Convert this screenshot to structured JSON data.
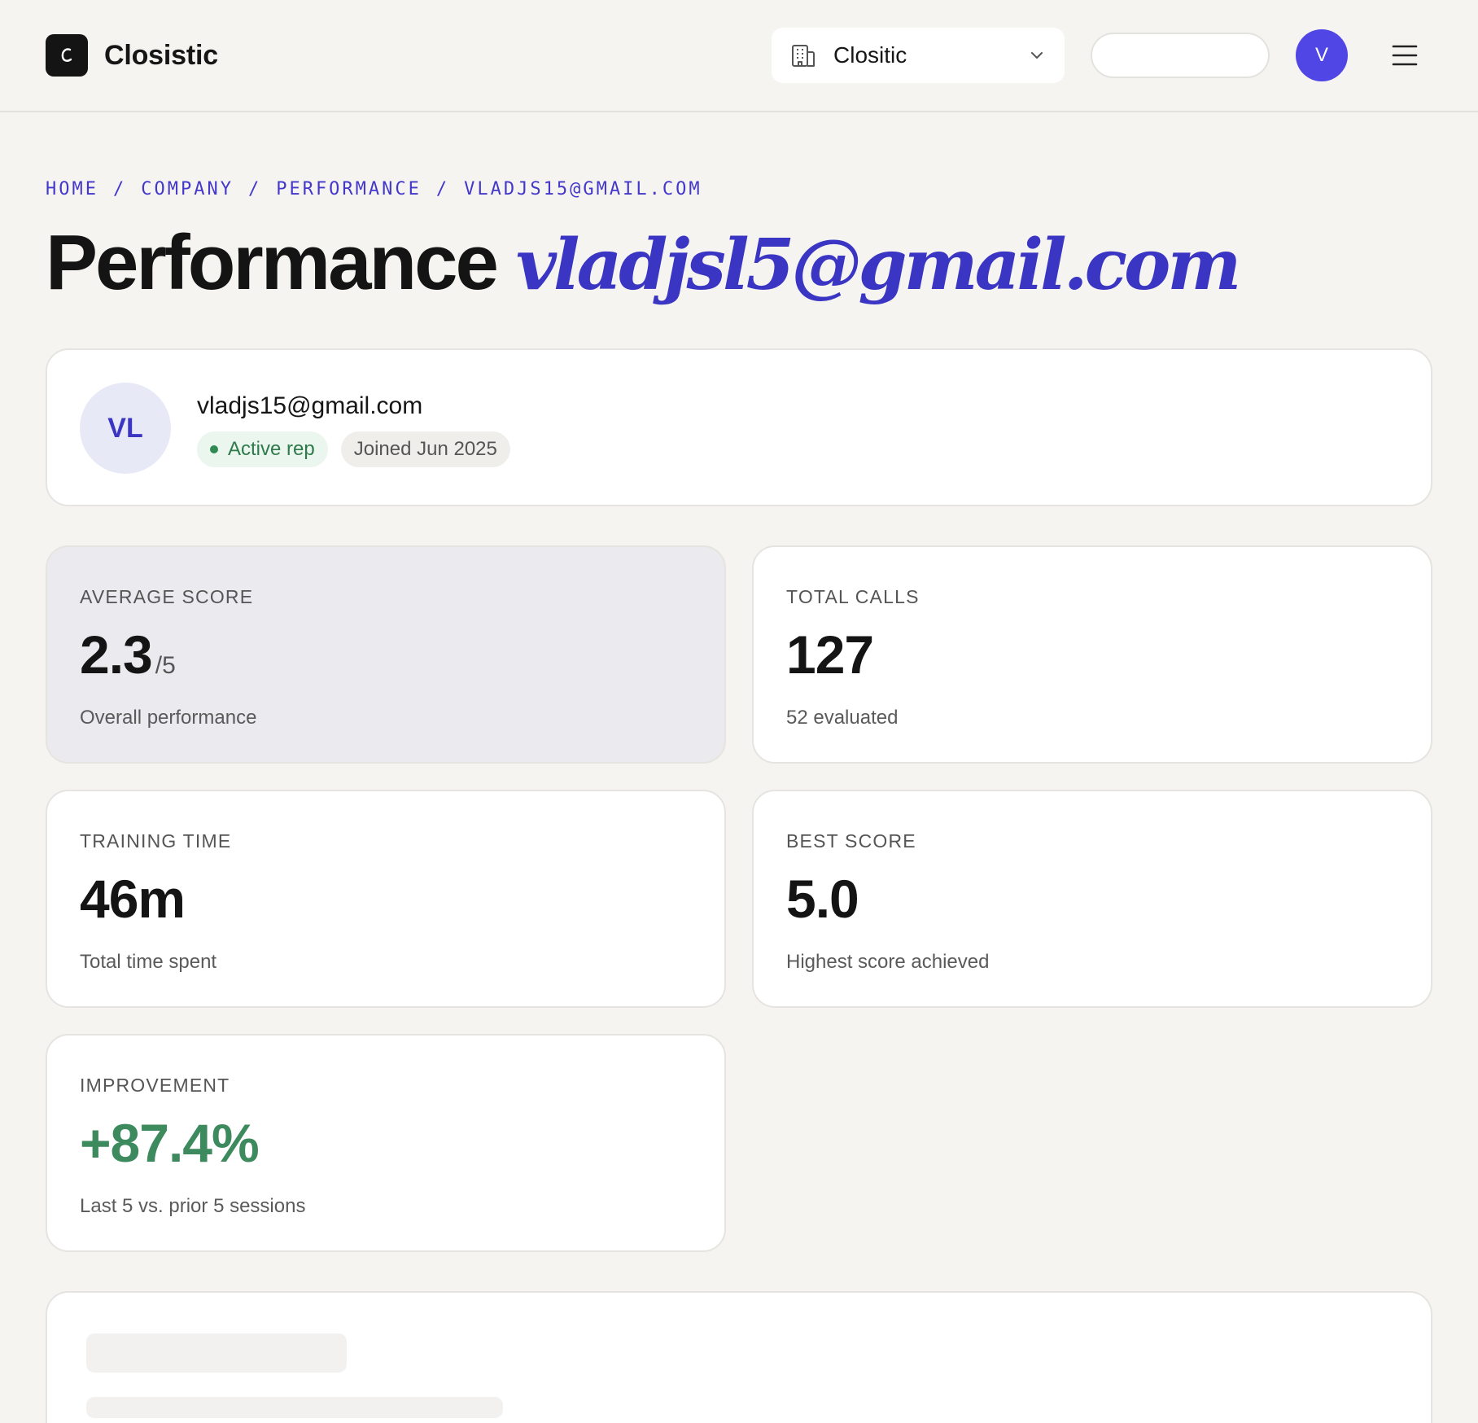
{
  "app": {
    "brand_name": "Closistic",
    "brand_logo_letter": "C"
  },
  "header": {
    "org_select": {
      "value": "Clositic",
      "icon": "building-icon"
    },
    "search": {
      "value": "",
      "placeholder": ""
    },
    "user_avatar_initial": "V",
    "menu_icon": "hamburger-icon"
  },
  "breadcrumb": {
    "items": [
      "HOME",
      "COMPANY",
      "PERFORMANCE",
      "VLADJS15@GMAIL.COM"
    ],
    "separator": "/"
  },
  "page_title": {
    "main": "Performance",
    "accent": "vladjsl5@gmail.com"
  },
  "profile": {
    "initials": "VL",
    "email": "vladjs15@gmail.com",
    "status_badge": "Active rep",
    "joined_badge": "Joined Jun 2025"
  },
  "stats": {
    "average_score": {
      "label": "AVERAGE SCORE",
      "value": "2.3",
      "suffix": "/5",
      "sub": "Overall performance"
    },
    "total_calls": {
      "label": "TOTAL CALLS",
      "value": "127",
      "sub": "52 evaluated"
    },
    "training_time": {
      "label": "TRAINING TIME",
      "value": "46m",
      "sub": "Total time spent"
    },
    "best_score": {
      "label": "BEST SCORE",
      "value": "5.0",
      "sub": "Highest score achieved"
    },
    "improvement": {
      "label": "IMPROVEMENT",
      "value": "+87.4%",
      "sub": "Last 5 vs. prior 5 sessions"
    }
  },
  "colors": {
    "accent": "#4338ca",
    "avatar": "#4f46e5",
    "positive": "#3d8a5e",
    "background": "#f5f4f1"
  }
}
